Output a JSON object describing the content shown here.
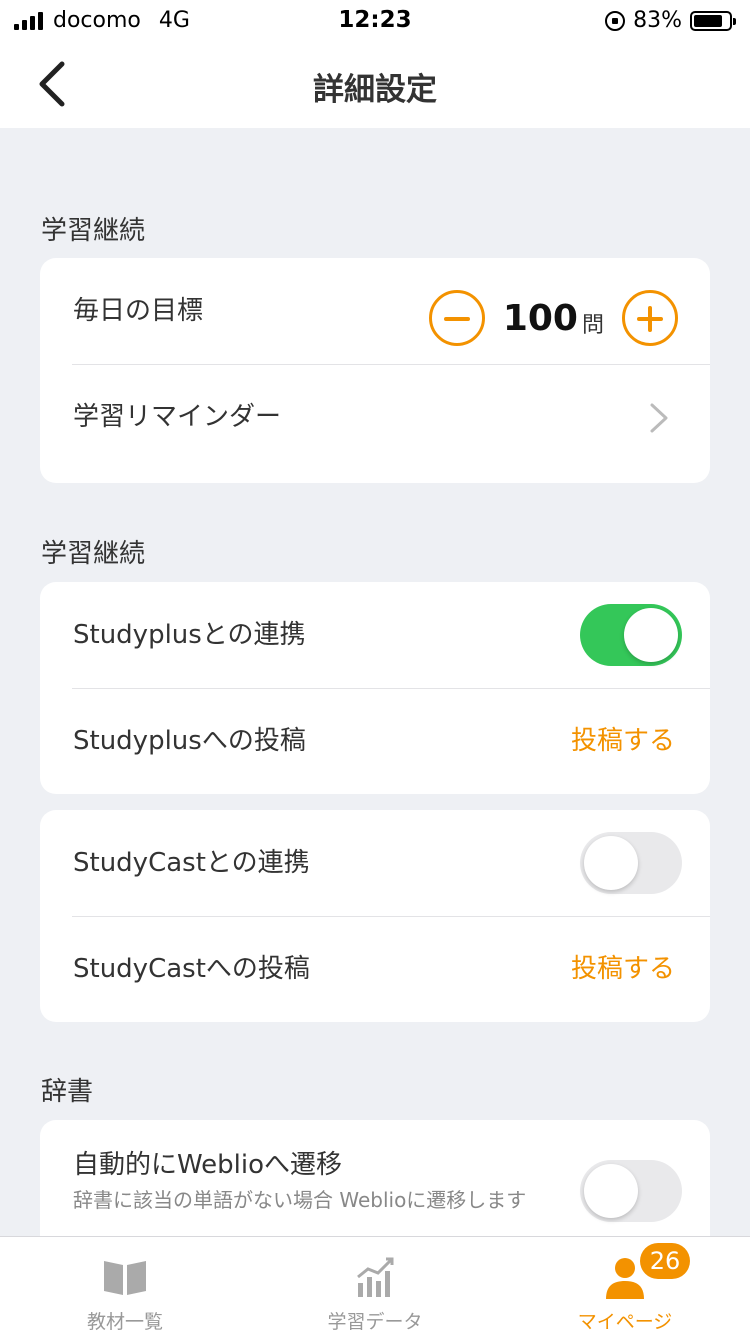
{
  "status_bar": {
    "carrier": "docomo",
    "network": "4G",
    "time": "12:23",
    "battery": "83%",
    "battery_level": 0.83
  },
  "nav": {
    "title": "詳細設定",
    "back_icon": "chevron-left-icon"
  },
  "sections": {
    "study_continuation_1": {
      "title": "学習継続",
      "daily_goal_label": "毎日の目標",
      "daily_goal_value": "100",
      "daily_goal_unit": "問",
      "reminder_label": "学習リマインダー"
    },
    "study_continuation_2": {
      "title": "学習継続",
      "studyplus_link_label": "Studyplusとの連携",
      "studyplus_link_on": true,
      "studyplus_post_label": "Studyplusへの投稿",
      "studyplus_post_action": "投稿する",
      "studycast_link_label": "StudyCastとの連携",
      "studycast_link_on": false,
      "studycast_post_label": "StudyCastへの投稿",
      "studycast_post_action": "投稿する"
    },
    "dictionary": {
      "title": "辞書",
      "weblio_label": "自動的にWeblioへ遷移",
      "weblio_desc": "辞書に該当の単語がない場合 Weblioに遷移します",
      "weblio_on": false
    }
  },
  "tab_bar": {
    "tabs": [
      {
        "label": "教材一覧",
        "icon": "book-icon",
        "active": false
      },
      {
        "label": "学習データ",
        "icon": "chart-icon",
        "active": false
      },
      {
        "label": "マイページ",
        "icon": "person-icon",
        "active": true,
        "badge": "26"
      }
    ]
  },
  "colors": {
    "accent": "#f39200",
    "toggle_on": "#34c759",
    "background": "#eef0f4"
  }
}
